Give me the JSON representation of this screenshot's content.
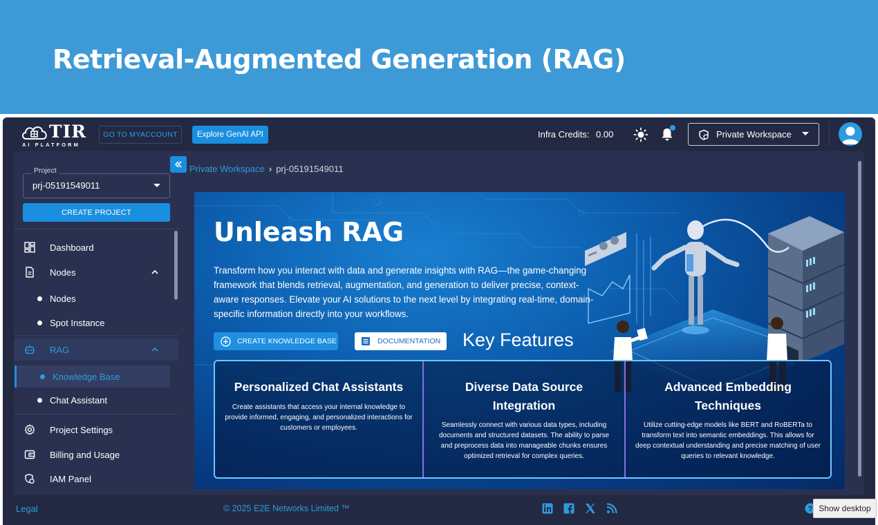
{
  "slide": {
    "title": "Retrieval-Augmented Generation (RAG)"
  },
  "topbar": {
    "logo_text": "TIR",
    "logo_sub": "AI PLATFORM",
    "myaccount_label": "GO TO MYACCOUNT",
    "genai_label": "Explore GenAI API",
    "credits_label": "Infra Credits:",
    "credits_value": "0.00",
    "workspace_label": "Private Workspace"
  },
  "sidebar": {
    "project_legend": "Project",
    "project_value": "prj-05191549011",
    "create_project_label": "CREATE PROJECT",
    "items": [
      {
        "label": "Dashboard",
        "icon": "dashboard-icon"
      },
      {
        "label": "Nodes",
        "icon": "document-icon"
      },
      {
        "label": "Nodes"
      },
      {
        "label": "Spot Instance"
      },
      {
        "label": "RAG",
        "icon": "robot-icon"
      },
      {
        "label": "Knowledge Base"
      },
      {
        "label": "Chat Assistant"
      },
      {
        "label": "Project Settings",
        "icon": "gear-icon"
      },
      {
        "label": "Billing and Usage",
        "icon": "wallet-icon"
      },
      {
        "label": "IAM Panel",
        "icon": "people-icon"
      }
    ]
  },
  "breadcrumb": {
    "link": "Private Workspace",
    "separator": "›",
    "current": "prj-05191549011"
  },
  "hero": {
    "title": "Unleash RAG",
    "description": "Transform how you interact with data and generate insights with RAG—the game-changing framework that blends retrieval, augmentation, and generation to deliver precise, context-aware responses. Elevate your AI solutions to the next level by integrating real-time, domain-specific information directly into your workflows.",
    "create_kb_label": "CREATE KNOWLEDGE BASE",
    "documentation_label": "DOCUMENTATION",
    "key_features": "Key Features",
    "features": [
      {
        "title": "Personalized Chat Assistants",
        "text": "Create assistants that access your internal knowledge to provide informed, engaging, and personalized interactions for customers or employees."
      },
      {
        "title": "Diverse Data Source Integration",
        "text": "Seamlessly connect with various data types, including documents and structured datasets. The ability to parse and preprocess data into manageable chunks ensures optimized retrieval for complex queries."
      },
      {
        "title": "Advanced Embedding Techniques",
        "text": "Utilize cutting-edge models like BERT and RoBERTa to transform text into semantic embeddings. This allows for deep contextual understanding and precise matching of user queries to relevant knowledge."
      }
    ]
  },
  "footer": {
    "legal": "Legal",
    "copyright": "© 2025 E2E Networks Limited ™",
    "social": [
      "linkedin-icon",
      "facebook-icon",
      "x-icon",
      "rss-icon"
    ]
  },
  "os": {
    "show_desktop": "Show desktop"
  },
  "colors": {
    "accent": "#1a8fe0",
    "app_bg": "#232942",
    "panel_bg": "#2a3150",
    "header_bg": "#3e9ad7"
  }
}
